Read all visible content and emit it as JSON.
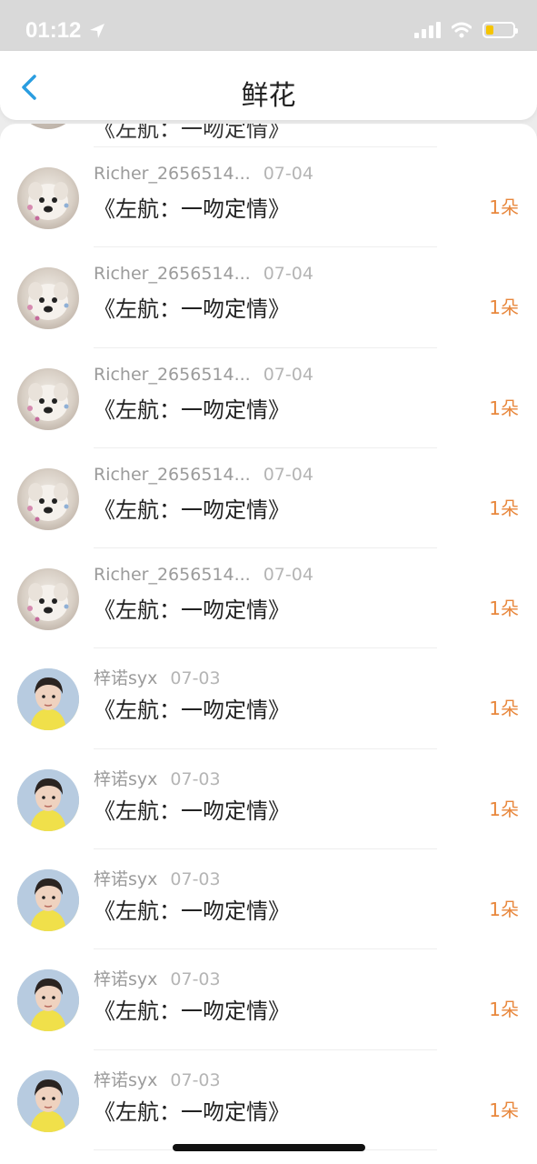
{
  "status_bar": {
    "time": "01:12",
    "battery_level": 0.3
  },
  "nav": {
    "title": "鲜花",
    "back_icon": "chevron-left-icon"
  },
  "partial_row": {
    "title": "《左航：一吻定情》"
  },
  "rows": [
    {
      "name": "Richer_2656514...",
      "date": "07-04",
      "title": "《左航：一吻定情》",
      "count": "1朵",
      "avatar": "dog"
    },
    {
      "name": "Richer_2656514...",
      "date": "07-04",
      "title": "《左航：一吻定情》",
      "count": "1朵",
      "avatar": "dog"
    },
    {
      "name": "Richer_2656514...",
      "date": "07-04",
      "title": "《左航：一吻定情》",
      "count": "1朵",
      "avatar": "dog"
    },
    {
      "name": "Richer_2656514...",
      "date": "07-04",
      "title": "《左航：一吻定情》",
      "count": "1朵",
      "avatar": "dog"
    },
    {
      "name": "Richer_2656514...",
      "date": "07-04",
      "title": "《左航：一吻定情》",
      "count": "1朵",
      "avatar": "dog"
    },
    {
      "name": "梓诺syx",
      "date": "07-03",
      "title": "《左航：一吻定情》",
      "count": "1朵",
      "avatar": "person"
    },
    {
      "name": "梓诺syx",
      "date": "07-03",
      "title": "《左航：一吻定情》",
      "count": "1朵",
      "avatar": "person"
    },
    {
      "name": "梓诺syx",
      "date": "07-03",
      "title": "《左航：一吻定情》",
      "count": "1朵",
      "avatar": "person"
    },
    {
      "name": "梓诺syx",
      "date": "07-03",
      "title": "《左航：一吻定情》",
      "count": "1朵",
      "avatar": "person"
    },
    {
      "name": "梓诺syx",
      "date": "07-03",
      "title": "《左航：一吻定情》",
      "count": "1朵",
      "avatar": "person"
    }
  ],
  "colors": {
    "accent": "#e8873c",
    "back": "#2a9de0"
  }
}
